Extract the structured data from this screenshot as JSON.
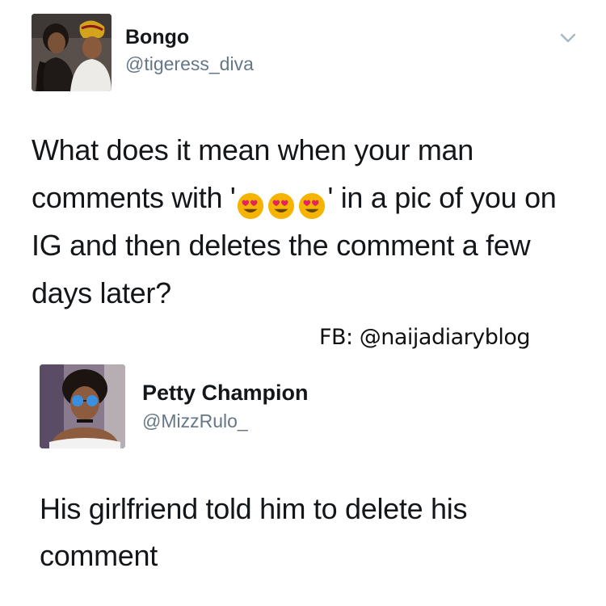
{
  "tweet1": {
    "author_name": "Bongo",
    "author_handle": "@tigeress_diva",
    "text_before": "What does it mean when your man comments with '",
    "emoji": [
      "heart-eyes-emoji",
      "heart-eyes-emoji",
      "heart-eyes-emoji"
    ],
    "text_after": "' in a pic of you on IG and then deletes the comment a few days later?"
  },
  "watermark": "FB: @naijadiaryblog",
  "tweet2": {
    "author_name": "Petty Champion",
    "author_handle": "@MizzRulo_",
    "text": "His girlfriend told him to delete his comment"
  },
  "colors": {
    "text": "#14171a",
    "secondary": "#657786",
    "emoji_face": "#f4b400",
    "emoji_heart": "#e0245e"
  }
}
